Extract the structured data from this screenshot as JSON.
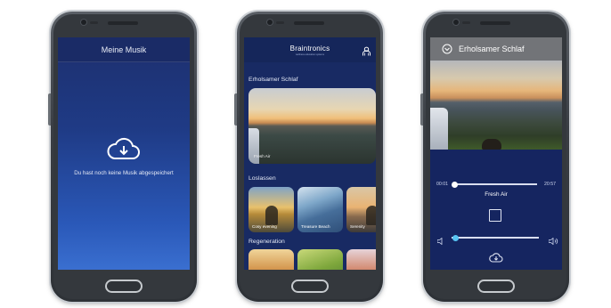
{
  "phone1": {
    "header_title": "Meine Musik",
    "empty_message": "Du hast noch keine Musik abgespeichert"
  },
  "phone2": {
    "brand": "Braintronics",
    "brand_sub": "wellness education systems",
    "section_1": "Erholsamer Schlaf",
    "hero_label": "Fresh Air",
    "section_2": "Loslassen",
    "tiles_loslassen": [
      "Cosy evening",
      "Treasure Beach",
      "Serenity"
    ],
    "section_3": "Regeneration"
  },
  "phone3": {
    "title": "Erholsamer Schlaf",
    "time_start": "00:01",
    "time_end": "20:57",
    "track_title": "Fresh Air",
    "progress": 0.0,
    "volume": 0.05
  },
  "colors": {
    "screen_blue": "#1f3b86",
    "header_gray": "#727478",
    "accent_cyan": "#57c4f2"
  }
}
